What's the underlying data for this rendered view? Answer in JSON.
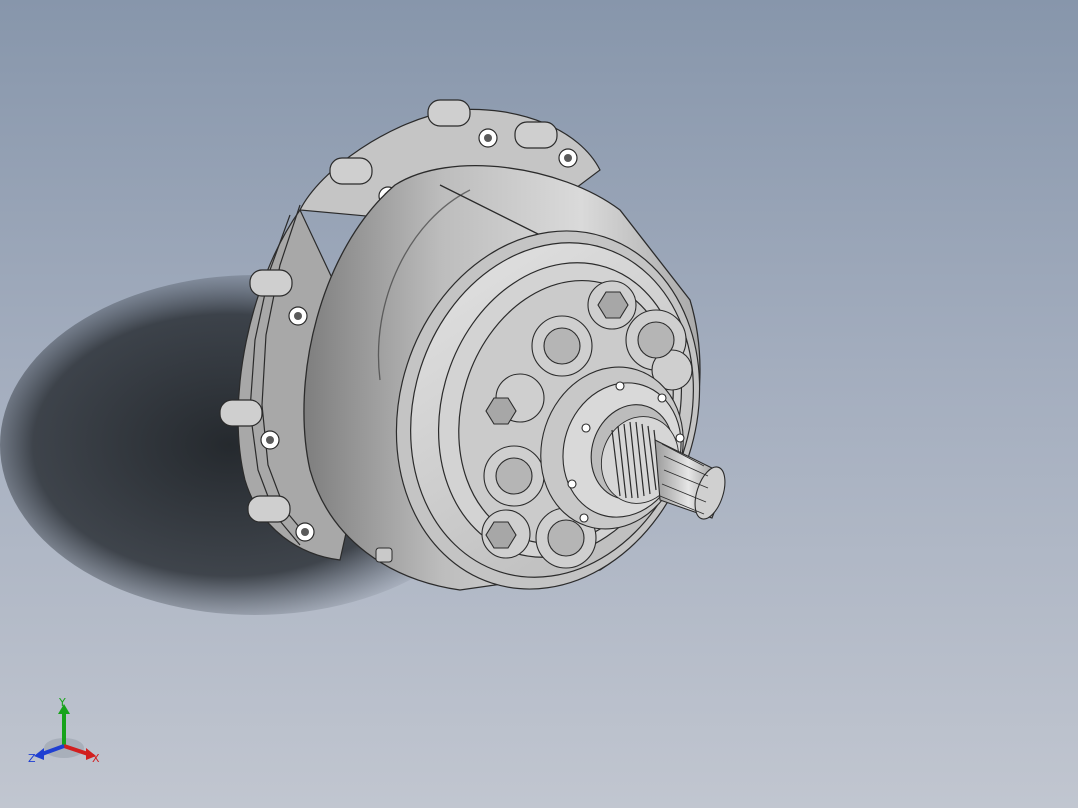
{
  "viewport": {
    "background_top": "#8796ab",
    "background_bottom": "#c1c6d0"
  },
  "model": {
    "description_icon": "motor-gearbox-assembly-icon",
    "body_color": "#c9c9c9",
    "edge_color": "#2b2b2b"
  },
  "triad": {
    "x_label": "X",
    "y_label": "Y",
    "z_label": "Z",
    "x_color": "#d21f1f",
    "y_color": "#17a31a",
    "z_color": "#1f3fd2"
  }
}
